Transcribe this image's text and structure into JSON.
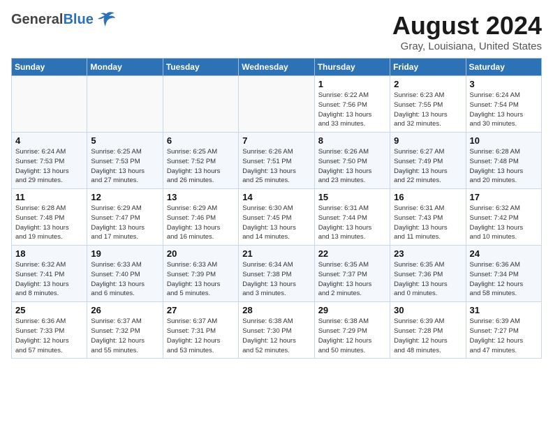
{
  "header": {
    "logo_general": "General",
    "logo_blue": "Blue",
    "month_title": "August 2024",
    "location": "Gray, Louisiana, United States"
  },
  "weekdays": [
    "Sunday",
    "Monday",
    "Tuesday",
    "Wednesday",
    "Thursday",
    "Friday",
    "Saturday"
  ],
  "weeks": [
    [
      {
        "num": "",
        "info": ""
      },
      {
        "num": "",
        "info": ""
      },
      {
        "num": "",
        "info": ""
      },
      {
        "num": "",
        "info": ""
      },
      {
        "num": "1",
        "info": "Sunrise: 6:22 AM\nSunset: 7:56 PM\nDaylight: 13 hours\nand 33 minutes."
      },
      {
        "num": "2",
        "info": "Sunrise: 6:23 AM\nSunset: 7:55 PM\nDaylight: 13 hours\nand 32 minutes."
      },
      {
        "num": "3",
        "info": "Sunrise: 6:24 AM\nSunset: 7:54 PM\nDaylight: 13 hours\nand 30 minutes."
      }
    ],
    [
      {
        "num": "4",
        "info": "Sunrise: 6:24 AM\nSunset: 7:53 PM\nDaylight: 13 hours\nand 29 minutes."
      },
      {
        "num": "5",
        "info": "Sunrise: 6:25 AM\nSunset: 7:53 PM\nDaylight: 13 hours\nand 27 minutes."
      },
      {
        "num": "6",
        "info": "Sunrise: 6:25 AM\nSunset: 7:52 PM\nDaylight: 13 hours\nand 26 minutes."
      },
      {
        "num": "7",
        "info": "Sunrise: 6:26 AM\nSunset: 7:51 PM\nDaylight: 13 hours\nand 25 minutes."
      },
      {
        "num": "8",
        "info": "Sunrise: 6:26 AM\nSunset: 7:50 PM\nDaylight: 13 hours\nand 23 minutes."
      },
      {
        "num": "9",
        "info": "Sunrise: 6:27 AM\nSunset: 7:49 PM\nDaylight: 13 hours\nand 22 minutes."
      },
      {
        "num": "10",
        "info": "Sunrise: 6:28 AM\nSunset: 7:48 PM\nDaylight: 13 hours\nand 20 minutes."
      }
    ],
    [
      {
        "num": "11",
        "info": "Sunrise: 6:28 AM\nSunset: 7:48 PM\nDaylight: 13 hours\nand 19 minutes."
      },
      {
        "num": "12",
        "info": "Sunrise: 6:29 AM\nSunset: 7:47 PM\nDaylight: 13 hours\nand 17 minutes."
      },
      {
        "num": "13",
        "info": "Sunrise: 6:29 AM\nSunset: 7:46 PM\nDaylight: 13 hours\nand 16 minutes."
      },
      {
        "num": "14",
        "info": "Sunrise: 6:30 AM\nSunset: 7:45 PM\nDaylight: 13 hours\nand 14 minutes."
      },
      {
        "num": "15",
        "info": "Sunrise: 6:31 AM\nSunset: 7:44 PM\nDaylight: 13 hours\nand 13 minutes."
      },
      {
        "num": "16",
        "info": "Sunrise: 6:31 AM\nSunset: 7:43 PM\nDaylight: 13 hours\nand 11 minutes."
      },
      {
        "num": "17",
        "info": "Sunrise: 6:32 AM\nSunset: 7:42 PM\nDaylight: 13 hours\nand 10 minutes."
      }
    ],
    [
      {
        "num": "18",
        "info": "Sunrise: 6:32 AM\nSunset: 7:41 PM\nDaylight: 13 hours\nand 8 minutes."
      },
      {
        "num": "19",
        "info": "Sunrise: 6:33 AM\nSunset: 7:40 PM\nDaylight: 13 hours\nand 6 minutes."
      },
      {
        "num": "20",
        "info": "Sunrise: 6:33 AM\nSunset: 7:39 PM\nDaylight: 13 hours\nand 5 minutes."
      },
      {
        "num": "21",
        "info": "Sunrise: 6:34 AM\nSunset: 7:38 PM\nDaylight: 13 hours\nand 3 minutes."
      },
      {
        "num": "22",
        "info": "Sunrise: 6:35 AM\nSunset: 7:37 PM\nDaylight: 13 hours\nand 2 minutes."
      },
      {
        "num": "23",
        "info": "Sunrise: 6:35 AM\nSunset: 7:36 PM\nDaylight: 13 hours\nand 0 minutes."
      },
      {
        "num": "24",
        "info": "Sunrise: 6:36 AM\nSunset: 7:34 PM\nDaylight: 12 hours\nand 58 minutes."
      }
    ],
    [
      {
        "num": "25",
        "info": "Sunrise: 6:36 AM\nSunset: 7:33 PM\nDaylight: 12 hours\nand 57 minutes."
      },
      {
        "num": "26",
        "info": "Sunrise: 6:37 AM\nSunset: 7:32 PM\nDaylight: 12 hours\nand 55 minutes."
      },
      {
        "num": "27",
        "info": "Sunrise: 6:37 AM\nSunset: 7:31 PM\nDaylight: 12 hours\nand 53 minutes."
      },
      {
        "num": "28",
        "info": "Sunrise: 6:38 AM\nSunset: 7:30 PM\nDaylight: 12 hours\nand 52 minutes."
      },
      {
        "num": "29",
        "info": "Sunrise: 6:38 AM\nSunset: 7:29 PM\nDaylight: 12 hours\nand 50 minutes."
      },
      {
        "num": "30",
        "info": "Sunrise: 6:39 AM\nSunset: 7:28 PM\nDaylight: 12 hours\nand 48 minutes."
      },
      {
        "num": "31",
        "info": "Sunrise: 6:39 AM\nSunset: 7:27 PM\nDaylight: 12 hours\nand 47 minutes."
      }
    ]
  ]
}
